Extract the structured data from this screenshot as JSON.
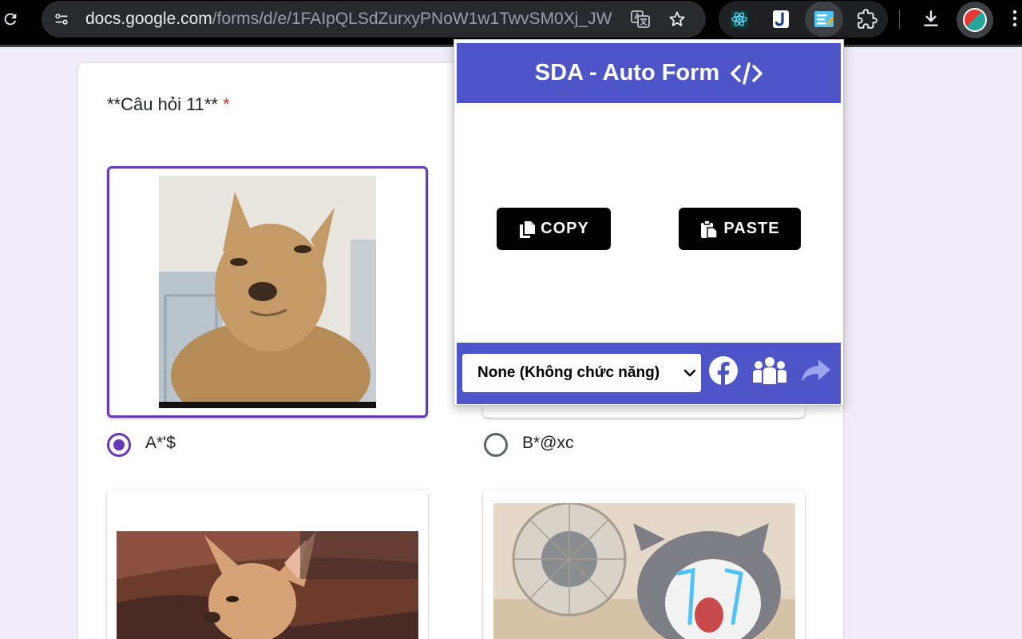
{
  "browser": {
    "url_domain": "docs.google.com",
    "url_path": "/forms/d/e/1FAIpQLSdZurxyPNoW1w1TwvSM0Xj_JW..."
  },
  "form": {
    "question_title": "**Câu hỏi 11**",
    "required_mark": "*",
    "options": [
      {
        "label": "A*'$",
        "selected": true
      },
      {
        "label": "B*@xc",
        "selected": false
      }
    ]
  },
  "popup": {
    "title": "SDA - Auto Form",
    "copy_label": "COPY",
    "paste_label": "PASTE",
    "mode_selected": "None (Không chức năng)"
  },
  "colors": {
    "accent": "#673ab7",
    "popup_brand": "#4e55c8",
    "required": "#d93025",
    "facebook": "#1877f2"
  },
  "icons": [
    "reload-icon",
    "site-info-icon",
    "translate-icon",
    "star-icon",
    "react-devtools-icon",
    "j-extension-icon",
    "sda-extension-icon",
    "puzzle-icon",
    "download-icon",
    "avatar",
    "more-vert-icon",
    "code-icon",
    "copy-icon",
    "paste-icon",
    "chevron-down-icon",
    "facebook-icon",
    "group-icon",
    "share-icon"
  ]
}
